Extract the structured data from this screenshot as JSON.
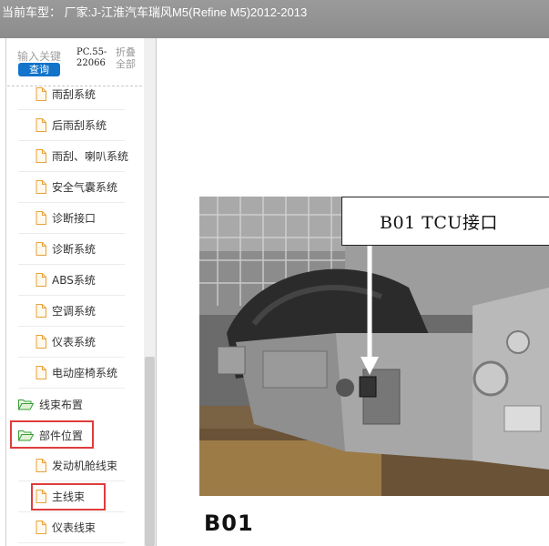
{
  "header": {
    "title": "当前车型： 厂家:J-江淮汽车瑞风M5(Refine M5)2012-2013"
  },
  "sidebar": {
    "search_placeholder": "输入关键",
    "query_label": "查询",
    "code_text": "PC.55-22066",
    "fold_all_label": "折叠全部",
    "items": [
      {
        "label": "雨刮系统",
        "type": "file"
      },
      {
        "label": "后雨刮系统",
        "type": "file"
      },
      {
        "label": "雨刮、喇叭系统",
        "type": "file"
      },
      {
        "label": "安全气囊系统",
        "type": "file"
      },
      {
        "label": "诊断接口",
        "type": "file"
      },
      {
        "label": "诊断系统",
        "type": "file"
      },
      {
        "label": "ABS系统",
        "type": "file"
      },
      {
        "label": "空调系统",
        "type": "file"
      },
      {
        "label": "仪表系统",
        "type": "file"
      },
      {
        "label": "电动座椅系统",
        "type": "file"
      },
      {
        "label": "线束布置",
        "type": "folder"
      },
      {
        "label": "部件位置",
        "type": "folder",
        "highlighted": true
      },
      {
        "label": "发动机舱线束",
        "type": "file"
      },
      {
        "label": "主线束",
        "type": "file",
        "highlighted": true
      },
      {
        "label": "仪表线束",
        "type": "file"
      }
    ]
  },
  "content": {
    "callout_text": "B01   TCU接口",
    "caption": "B01"
  },
  "colors": {
    "header_bg": "#8c8c8c",
    "query_button": "#1173c9",
    "highlight_box": "#e03c3c",
    "folder_green": "#3a9d3a",
    "file_orange": "#e8a23a"
  }
}
